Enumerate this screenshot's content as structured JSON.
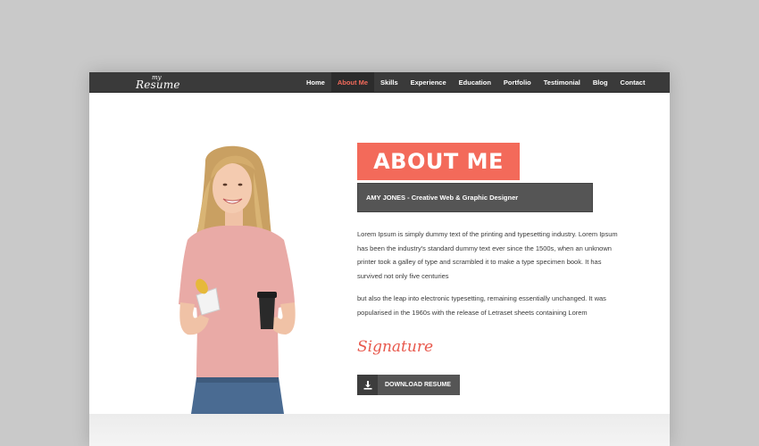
{
  "brand": {
    "logo_small": "my",
    "logo_word": "Resume"
  },
  "nav": {
    "items": [
      {
        "label": "Home"
      },
      {
        "label": "About Me"
      },
      {
        "label": "Skills"
      },
      {
        "label": "Experience"
      },
      {
        "label": "Education"
      },
      {
        "label": "Portfolio"
      },
      {
        "label": "Testimonial"
      },
      {
        "label": "Blog"
      },
      {
        "label": "Contact"
      }
    ],
    "active": "About Me",
    "accent_color": "#f36a5a"
  },
  "about": {
    "title": "ABOUT ME",
    "subtitle": "AMY JONES - Creative Web & Graphic Designer",
    "paragraph1": "Lorem Ipsum is simply dummy text of the printing and typesetting industry. Lorem Ipsum has been the industry's standard dummy text ever since the 1500s, when an unknown printer took a galley of type and scrambled it to make a type specimen book. It has survived not only five centuries",
    "paragraph2": "but also the leap into electronic typesetting, remaining essentially unchanged. It was popularised in the 1960s with the release of Letraset sheets containing Lorem",
    "signature": "Signature",
    "download_label": "DOWNLOAD RESUME",
    "download_icon": "download-icon"
  },
  "photo": {
    "subject": "profile-photo"
  }
}
